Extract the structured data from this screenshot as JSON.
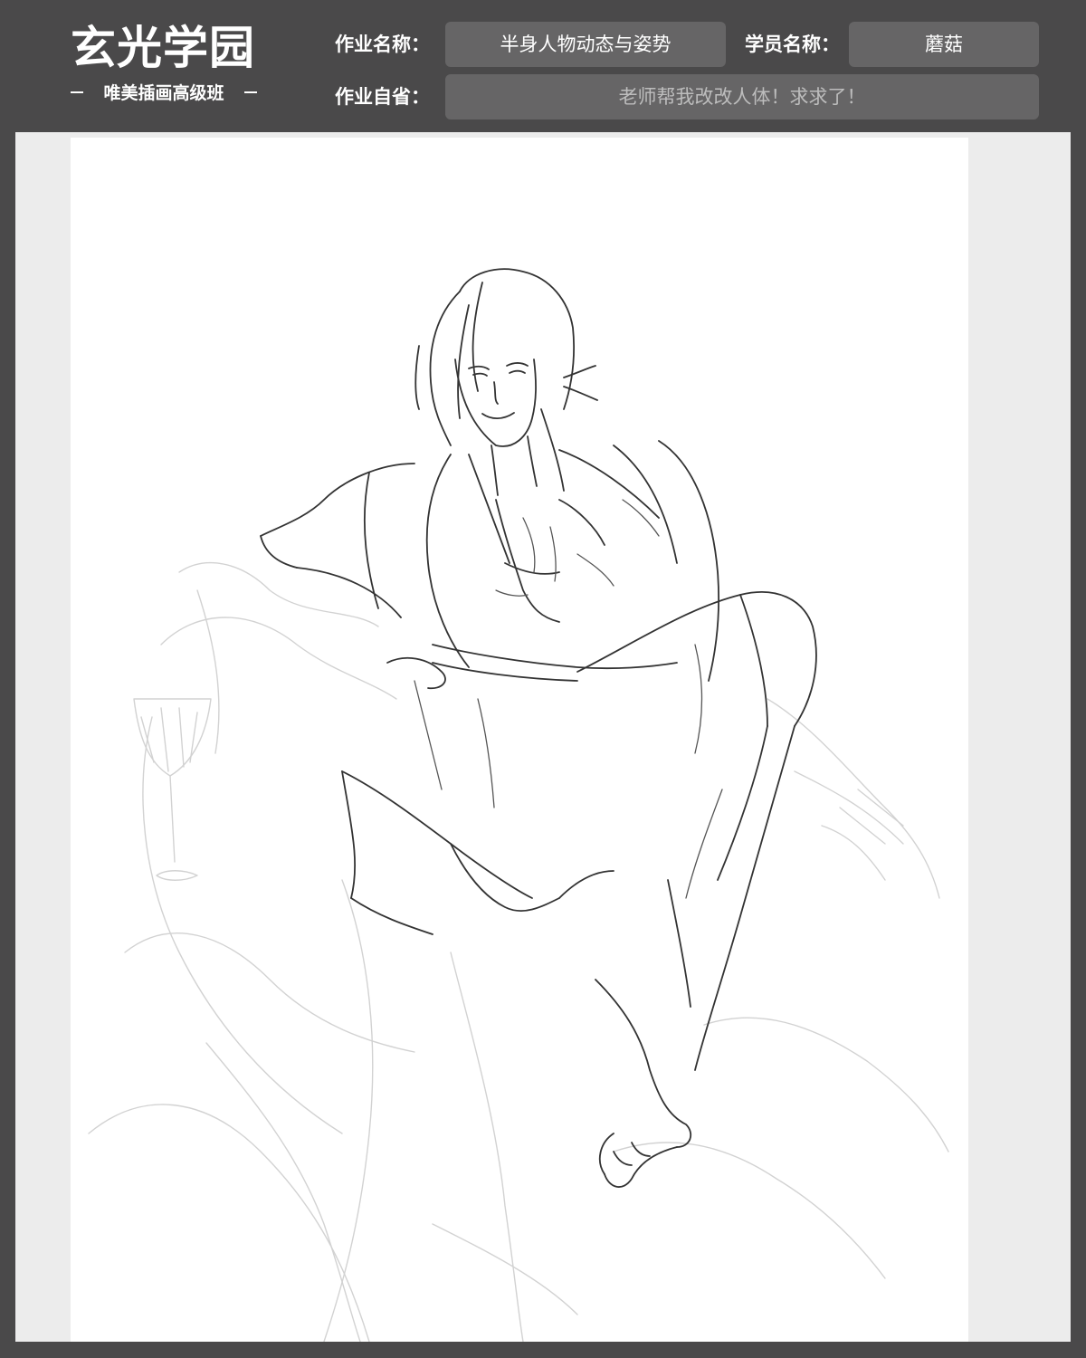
{
  "header": {
    "logo_title": "玄光学园",
    "logo_subtitle": "唯美插画高级班",
    "assignment_name_label": "作业名称：",
    "assignment_name_value": "半身人物动态与姿势",
    "student_name_label": "学员名称：",
    "student_name_value": "蘑菇",
    "self_review_label": "作业自省：",
    "self_review_value": "老师帮我改改人体！求求了！"
  },
  "artwork": {
    "subject": "pencil sketch of a long-haired figure in a loose robe seated with one knee raised, wine glass at left"
  },
  "colors": {
    "background": "#4a494a",
    "field_box": "#666566",
    "canvas_frame": "#ececec",
    "paper": "#ffffff",
    "sketch_line": "#333333"
  }
}
